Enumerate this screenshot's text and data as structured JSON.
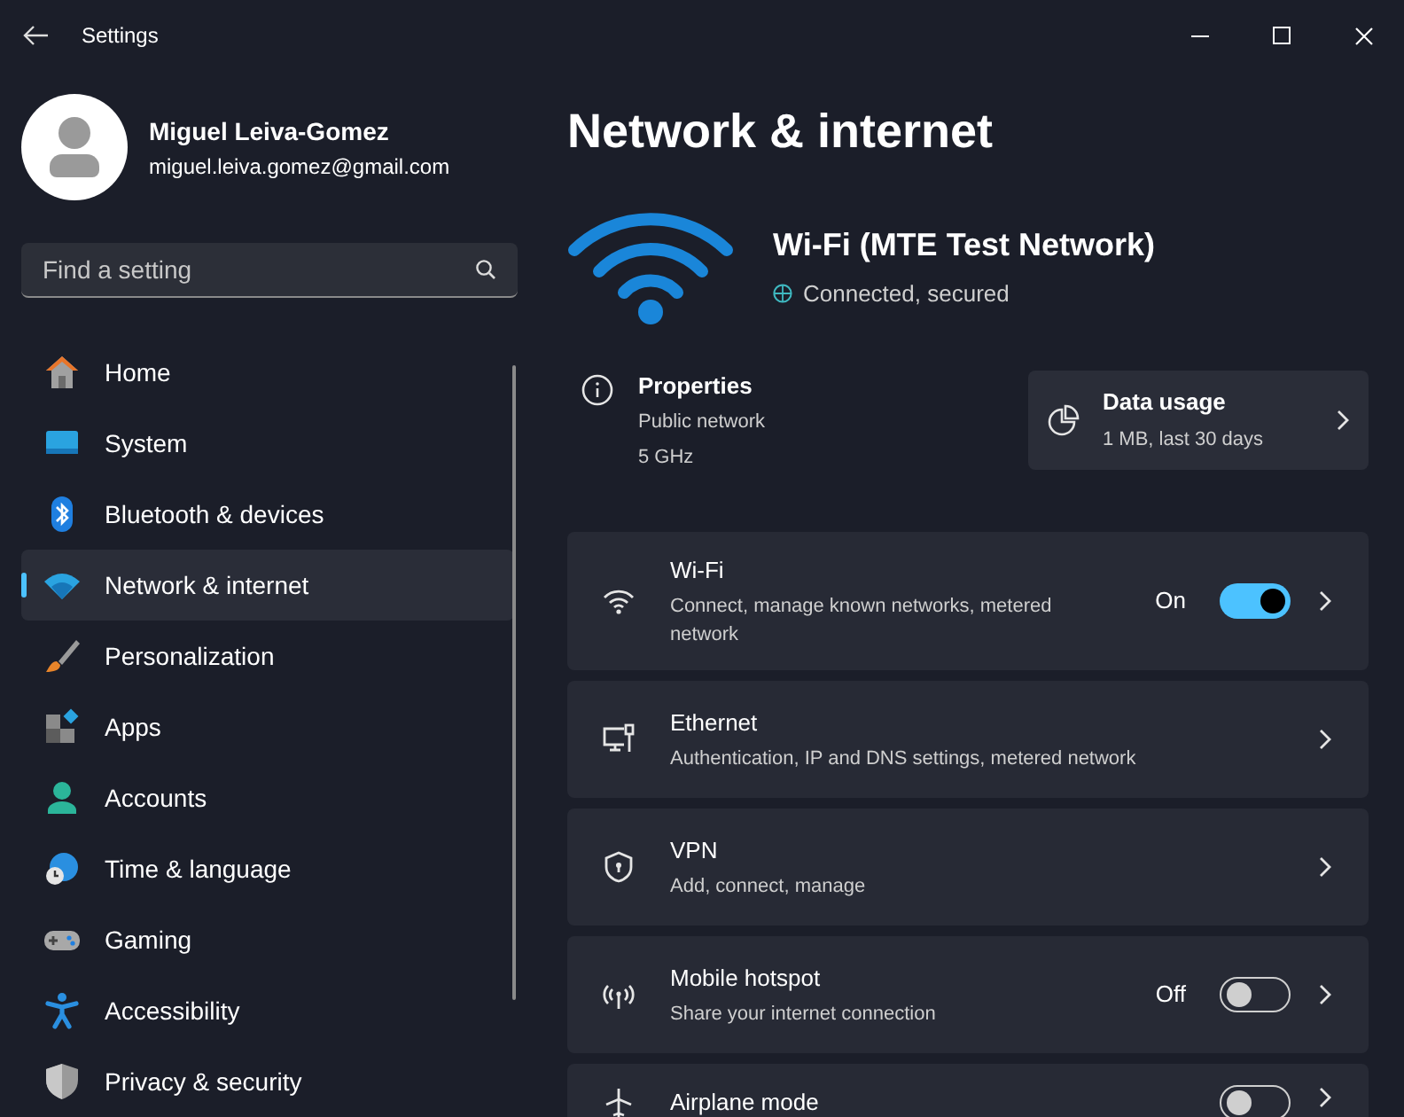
{
  "window": {
    "title": "Settings"
  },
  "profile": {
    "name": "Miguel Leiva-Gomez",
    "email": "miguel.leiva.gomez@gmail.com"
  },
  "search": {
    "placeholder": "Find a setting"
  },
  "sidebar": {
    "items": [
      {
        "label": "Home",
        "selected": false
      },
      {
        "label": "System",
        "selected": false
      },
      {
        "label": "Bluetooth & devices",
        "selected": false
      },
      {
        "label": "Network & internet",
        "selected": true
      },
      {
        "label": "Personalization",
        "selected": false
      },
      {
        "label": "Apps",
        "selected": false
      },
      {
        "label": "Accounts",
        "selected": false
      },
      {
        "label": "Time & language",
        "selected": false
      },
      {
        "label": "Gaming",
        "selected": false
      },
      {
        "label": "Accessibility",
        "selected": false
      },
      {
        "label": "Privacy & security",
        "selected": false
      }
    ]
  },
  "page": {
    "title": "Network & internet"
  },
  "connection": {
    "name": "Wi-Fi (MTE Test Network)",
    "status": "Connected, secured"
  },
  "properties": {
    "title": "Properties",
    "lines": [
      "Public network",
      "5 GHz"
    ]
  },
  "data_usage": {
    "title": "Data usage",
    "detail": "1 MB, last 30 days"
  },
  "rows": [
    {
      "kind": "toggle",
      "title": "Wi-Fi",
      "subtitle": "Connect, manage known networks, metered network",
      "state_text": "On",
      "on": true
    },
    {
      "kind": "link",
      "title": "Ethernet",
      "subtitle": "Authentication, IP and DNS settings, metered network"
    },
    {
      "kind": "link",
      "title": "VPN",
      "subtitle": "Add, connect, manage"
    },
    {
      "kind": "toggle",
      "title": "Mobile hotspot",
      "subtitle": "Share your internet connection",
      "state_text": "Off",
      "on": false
    },
    {
      "kind": "toggle",
      "title": "Airplane mode",
      "on": false
    }
  ]
}
